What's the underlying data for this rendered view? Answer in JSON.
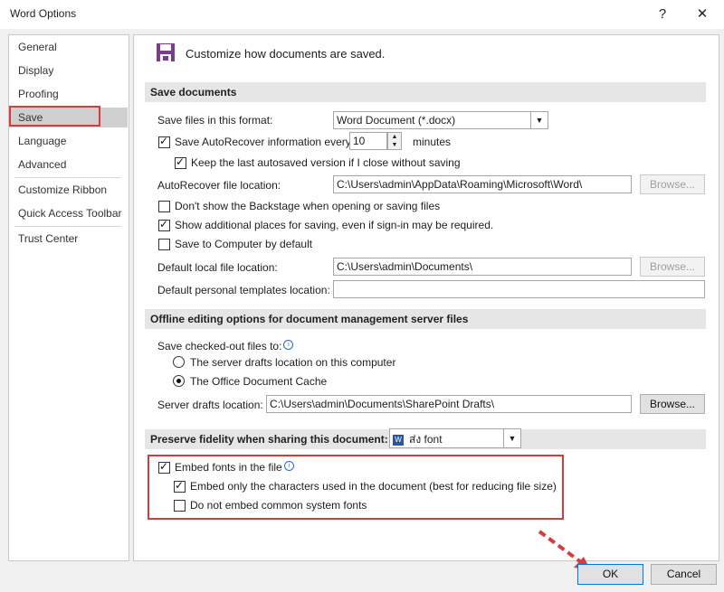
{
  "window": {
    "title": "Word Options",
    "help": "?",
    "close": "✕"
  },
  "sidebar": {
    "items": [
      {
        "label": "General"
      },
      {
        "label": "Display"
      },
      {
        "label": "Proofing"
      },
      {
        "label": "Save",
        "selected": true
      },
      {
        "label": "Language"
      },
      {
        "label": "Advanced"
      },
      {
        "label": "Customize Ribbon"
      },
      {
        "label": "Quick Access Toolbar"
      },
      {
        "label": "Trust Center"
      }
    ]
  },
  "header": {
    "icon": "save-disk-icon",
    "text": "Customize how documents are saved."
  },
  "save_documents": {
    "title": "Save documents",
    "format_label": "Save files in this format:",
    "format_value": "Word Document (*.docx)",
    "autorecover_label": "Save AutoRecover information every",
    "autorecover_checked": true,
    "autorecover_minutes": "10",
    "minutes_label": "minutes",
    "keep_last_label": "Keep the last autosaved version if I close without saving",
    "keep_last_checked": true,
    "autorecover_location_label": "AutoRecover file location:",
    "autorecover_location_value": "C:\\Users\\admin\\AppData\\Roaming\\Microsoft\\Word\\",
    "browse": "Browse...",
    "backstage_label": "Don't show the Backstage when opening or saving files",
    "backstage_checked": false,
    "additional_places_label": "Show additional places for saving, even if sign-in may be required.",
    "additional_places_checked": true,
    "save_to_computer_label": "Save to Computer by default",
    "save_to_computer_checked": false,
    "default_local_label": "Default local file location:",
    "default_local_value": "C:\\Users\\admin\\Documents\\",
    "personal_templates_label": "Default personal templates location:",
    "personal_templates_value": ""
  },
  "offline": {
    "title": "Offline editing options for document management server files",
    "checked_out_label": "Save checked-out files to:",
    "option_server": "The server drafts location on this computer",
    "option_cache": "The Office Document Cache",
    "selected": "cache",
    "server_drafts_label": "Server drafts location:",
    "server_drafts_value": "C:\\Users\\admin\\Documents\\SharePoint Drafts\\",
    "browse": "Browse..."
  },
  "fidelity": {
    "title": "Preserve fidelity when sharing this document:",
    "document_value": "ส่ง font",
    "embed_fonts_label": "Embed fonts in the file",
    "embed_fonts_checked": true,
    "embed_only_label": "Embed only the characters used in the document (best for reducing file size)",
    "embed_only_checked": true,
    "no_common_label": "Do not embed common system fonts",
    "no_common_checked": false
  },
  "footer": {
    "ok": "OK",
    "cancel": "Cancel"
  },
  "colors": {
    "highlight_red": "#d83b3b",
    "info_blue": "#2b6cc4",
    "save_icon_purple": "#7a3c8e"
  }
}
